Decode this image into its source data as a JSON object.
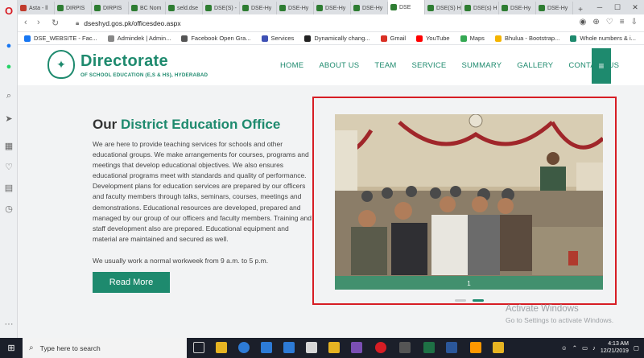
{
  "browser": {
    "tabs": [
      {
        "label": "Asta - ll",
        "color": "#c0392b",
        "active": false
      },
      {
        "label": "DIRPIS",
        "color": "#2e7d32",
        "active": false
      },
      {
        "label": "DIRPIS",
        "color": "#2e7d32",
        "active": false
      },
      {
        "label": "BC Nom",
        "color": "#2e7d32",
        "active": false
      },
      {
        "label": "seld.dse",
        "color": "#2e7d32",
        "active": false
      },
      {
        "label": "DSE(S) -",
        "color": "#2e7d32",
        "active": false
      },
      {
        "label": "DSE-Hy",
        "color": "#2e7d32",
        "active": false
      },
      {
        "label": "DSE-Hy",
        "color": "#2e7d32",
        "active": false
      },
      {
        "label": "DSE-Hy",
        "color": "#2e7d32",
        "active": false
      },
      {
        "label": "DSE-Hy",
        "color": "#2e7d32",
        "active": false
      },
      {
        "label": "DSE",
        "color": "#2e7d32",
        "active": true
      },
      {
        "label": "DSE(S) H",
        "color": "#2e7d32",
        "active": false
      },
      {
        "label": "DSE(s) H",
        "color": "#2e7d32",
        "active": false
      },
      {
        "label": "DSE-Hy",
        "color": "#2e7d32",
        "active": false
      },
      {
        "label": "DSE-Hy",
        "color": "#2e7d32",
        "active": false
      }
    ],
    "new_tab_icon": "+",
    "url": "dseshyd.gos.pk/officesdeo.aspx",
    "bookmarks": [
      {
        "label": "DSE_WEBSITE - Fac...",
        "color": "#1877f2"
      },
      {
        "label": "Admindek | Admin...",
        "color": "#888888"
      },
      {
        "label": "Facebook Open Gra...",
        "color": "#555555"
      },
      {
        "label": "Services",
        "color": "#3f51b5"
      },
      {
        "label": "Dynamically chang...",
        "color": "#222222"
      },
      {
        "label": "Gmail",
        "color": "#d93025"
      },
      {
        "label": "YouTube",
        "color": "#ff0000"
      },
      {
        "label": "Maps",
        "color": "#34a853"
      },
      {
        "label": "Bhulua - Bootstrap...",
        "color": "#f4b400"
      },
      {
        "label": "Whole numbers & i...",
        "color": "#1e8a6e"
      }
    ]
  },
  "site": {
    "brand": "Directorate",
    "brand_sub": "OF SCHOOL EDUCATION (E,S & HS), HYDERABAD",
    "nav": [
      "HOME",
      "ABOUT US",
      "TEAM",
      "SERVICE",
      "SUMMARY",
      "GALLERY",
      "CONTACT US"
    ],
    "menu_icon": "≡"
  },
  "content": {
    "title_lead": "Our",
    "title_accent": "District Education Office",
    "body": "We are here to provide teaching services for schools and other educational groups. We make arrangements for courses, programs and meetings that develop educational objectives. We also ensures educational programs meet with standards and quality of performance. Development plans for education services are prepared by our officers and faculty members through talks, seminars, courses, meetings and demonstrations. Educational resources are developed, prepared and managed by our group of our officers and faculty members. Training and staff development also are prepared. Educational equipment and material are maintained and secured as well.",
    "hours": "We usually work a normal workweek from 9 a.m. to 5 p.m.",
    "read_more": "Read More"
  },
  "slider": {
    "current": "1",
    "dots": 2,
    "active_dot": 1
  },
  "watermark": {
    "line1": "Activate Windows",
    "line2": "Go to Settings to activate Windows."
  },
  "taskbar": {
    "search_placeholder": "Type here to search",
    "time": "4:13 AM",
    "date": "12/21/2019"
  },
  "colors": {
    "accent": "#1e8a6e",
    "highlight": "#d71d24"
  }
}
